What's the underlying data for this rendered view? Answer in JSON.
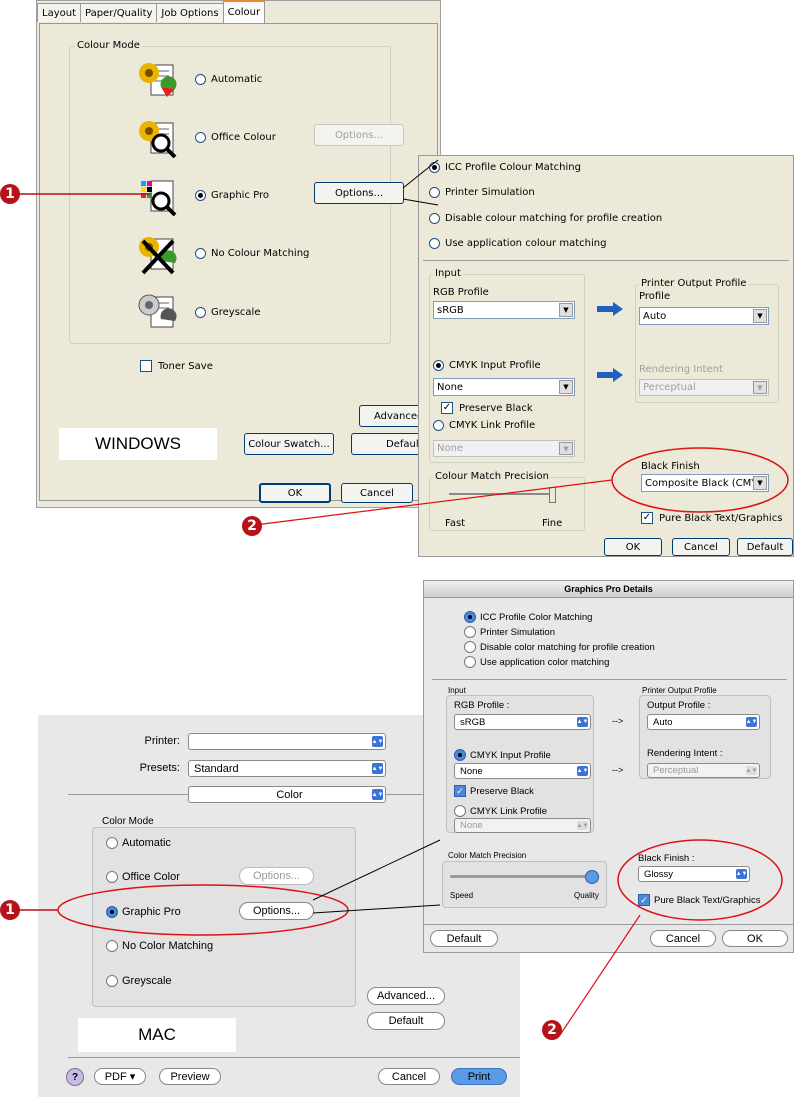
{
  "windows": {
    "tabs": [
      "Layout",
      "Paper/Quality",
      "Job Options",
      "Colour"
    ],
    "colour_mode_label": "Colour Mode",
    "options": [
      {
        "label": "Automatic",
        "selected": false,
        "has_button": false
      },
      {
        "label": "Office Colour",
        "selected": false,
        "has_button": true,
        "button_label": "Options...",
        "button_enabled": false
      },
      {
        "label": "Graphic Pro",
        "selected": true,
        "has_button": true,
        "button_label": "Options...",
        "button_enabled": true
      },
      {
        "label": "No Colour Matching",
        "selected": false,
        "has_button": false
      },
      {
        "label": "Greyscale",
        "selected": false,
        "has_button": false
      }
    ],
    "toner_save": "Toner Save",
    "advanced_btn": "Advanced",
    "colour_swatch_btn": "Colour Swatch...",
    "default_btn": "Default",
    "ok_btn": "OK",
    "cancel_btn": "Cancel",
    "platform_label": "WINDOWS",
    "details": {
      "modes": [
        {
          "label": "ICC Profile Colour Matching",
          "selected": true
        },
        {
          "label": "Printer Simulation",
          "selected": false
        },
        {
          "label": "Disable colour matching for profile creation",
          "selected": false
        },
        {
          "label": "Use application colour matching",
          "selected": false
        }
      ],
      "input_label": "Input",
      "rgb_profile_label": "RGB Profile",
      "rgb_profile_value": "sRGB",
      "cmyk_input_label": "CMYK Input Profile",
      "cmyk_input_value": "None",
      "preserve_black": "Preserve Black",
      "cmyk_link_label": "CMYK Link Profile",
      "cmyk_link_value": "None",
      "printer_output_label": "Printer Output Profile",
      "profile_label": "Profile",
      "profile_value": "Auto",
      "rendering_intent_label": "Rendering Intent",
      "rendering_intent_value": "Perceptual",
      "precision_label": "Colour Match Precision",
      "fast": "Fast",
      "fine": "Fine",
      "black_finish_label": "Black Finish",
      "black_finish_value": "Composite Black (CMYK)",
      "pure_black": "Pure Black Text/Graphics",
      "ok": "OK",
      "cancel": "Cancel",
      "default": "Default"
    }
  },
  "mac": {
    "printer_label": "Printer:",
    "presets_label": "Presets:",
    "presets_value": "Standard",
    "panel_value": "Color",
    "color_mode_label": "Color Mode",
    "options": [
      {
        "label": "Automatic",
        "selected": false
      },
      {
        "label": "Office Color",
        "selected": false,
        "button_label": "Options...",
        "button_enabled": false
      },
      {
        "label": "Graphic Pro",
        "selected": true,
        "button_label": "Options...",
        "button_enabled": true
      },
      {
        "label": "No Color Matching",
        "selected": false
      },
      {
        "label": "Greyscale",
        "selected": false
      }
    ],
    "advanced_btn": "Advanced...",
    "default_btn": "Default",
    "platform_label": "MAC",
    "help": "?",
    "pdf_btn": "PDF ▾",
    "preview_btn": "Preview",
    "cancel_btn": "Cancel",
    "print_btn": "Print",
    "details": {
      "title": "Graphics Pro Details",
      "modes": [
        {
          "label": "ICC Profile Color Matching",
          "selected": true
        },
        {
          "label": "Printer Simulation",
          "selected": false
        },
        {
          "label": "Disable color matching for profile creation",
          "selected": false
        },
        {
          "label": "Use application color matching",
          "selected": false
        }
      ],
      "input_label": "Input",
      "rgb_profile_label": "RGB Profile :",
      "rgb_profile_value": "sRGB",
      "cmyk_input_label": "CMYK Input Profile",
      "cmyk_input_value": "None",
      "preserve_black": "Preserve Black",
      "cmyk_link_label": "CMYK Link Profile",
      "cmyk_link_value": "None",
      "arrow_text": "-->",
      "printer_output_label": "Printer Output Profile",
      "output_profile_label": "Output Profile :",
      "output_profile_value": "Auto",
      "rendering_intent_label": "Rendering Intent :",
      "rendering_intent_value": "Perceptual",
      "precision_label": "Color Match Precision",
      "speed": "Speed",
      "quality": "Quality",
      "black_finish_label": "Black Finish :",
      "black_finish_value": "Glossy",
      "pure_black": "Pure Black Text/Graphics",
      "default": "Default",
      "cancel": "Cancel",
      "ok": "OK"
    }
  },
  "callouts": [
    "1",
    "2",
    "1",
    "2"
  ],
  "colors": {
    "callout_red": "#b8111a",
    "arrow_blue": "#2060c0",
    "mac_blue": "#4d87d8"
  }
}
